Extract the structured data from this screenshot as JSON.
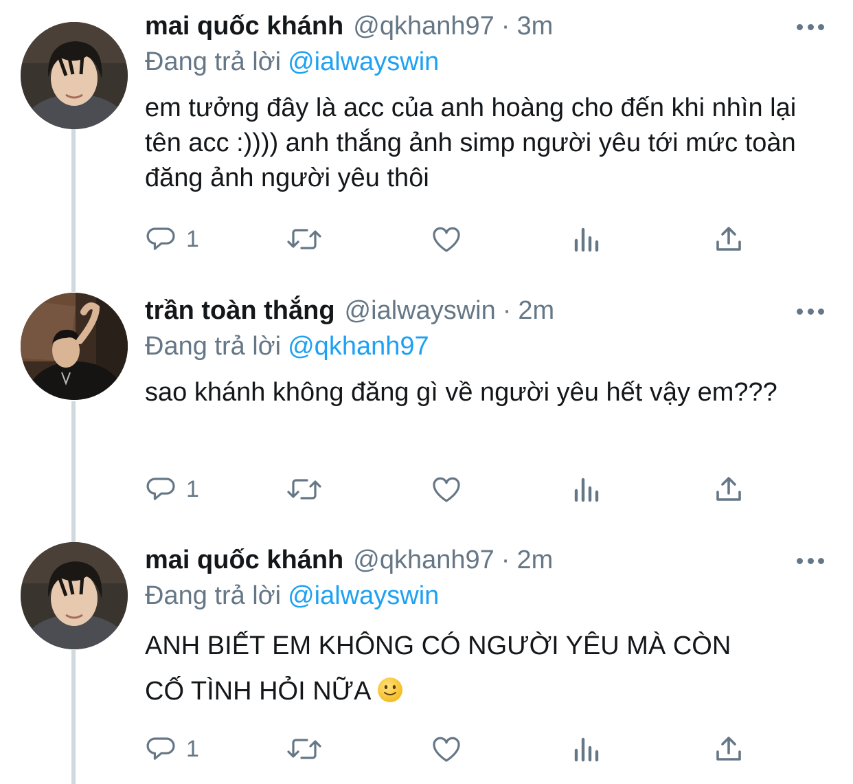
{
  "tweets": [
    {
      "name": "mai quốc khánh",
      "handle": "@qkhanh97",
      "separator": "·",
      "time": "3m",
      "reply_label": "Đang trả lời",
      "reply_to": "@ialwayswin",
      "text": "em tưởng đây là acc của anh hoàng cho đến khi nhìn lại tên acc :)))) anh thắng ảnh simp người yêu tới mức toàn đăng ảnh người yêu thôi",
      "reply_count": "1",
      "avatar": "avatar-khanh"
    },
    {
      "name": "trần toàn thắng",
      "handle": "@ialwayswin",
      "separator": "·",
      "time": "2m",
      "reply_label": "Đang trả lời",
      "reply_to": "@qkhanh97",
      "text": "sao khánh không đăng gì về người yêu hết vậy em???",
      "reply_count": "1",
      "avatar": "avatar-thang"
    },
    {
      "name": "mai quốc khánh",
      "handle": "@qkhanh97",
      "separator": "·",
      "time": "2m",
      "reply_label": "Đang trả lời",
      "reply_to": "@ialwayswin",
      "text_line1": "ANH BIẾT EM KHÔNG CÓ NGƯỜI YÊU MÀ CÒN",
      "text_line2": "CỐ TÌNH HỎI NỮA",
      "emoji": "slightly-smiling-face",
      "reply_count": "1",
      "avatar": "avatar-khanh"
    }
  ],
  "icons": {
    "reply": "reply-icon",
    "retweet": "retweet-icon",
    "like": "heart-icon",
    "analytics": "analytics-icon",
    "share": "share-icon",
    "more": "more-options-icon"
  },
  "colors": {
    "text": "#14171a",
    "secondary": "#657786",
    "link": "#1da1f2",
    "thread_line": "#cfd9de"
  }
}
